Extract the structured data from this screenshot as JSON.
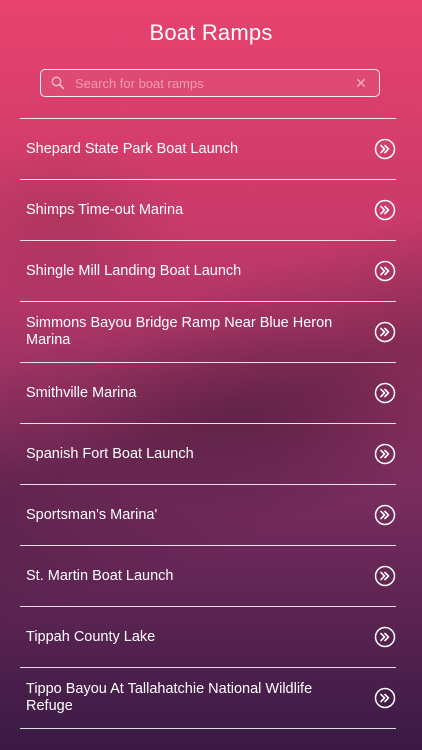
{
  "header": {
    "title": "Boat Ramps"
  },
  "search": {
    "placeholder": "Search for boat ramps",
    "value": ""
  },
  "icons": {
    "search": "search-icon",
    "clear": "close-icon",
    "row": "double-chevron-right-icon"
  },
  "list": {
    "items": [
      {
        "label": "Shepard State Park Boat Launch"
      },
      {
        "label": "Shimps Time-out Marina"
      },
      {
        "label": "Shingle Mill Landing Boat Launch"
      },
      {
        "label": "Simmons Bayou Bridge Ramp Near Blue Heron Marina"
      },
      {
        "label": "Smithville Marina"
      },
      {
        "label": "Spanish Fort Boat Launch"
      },
      {
        "label": "Sportsman's Marina'"
      },
      {
        "label": "St. Martin Boat Launch"
      },
      {
        "label": "Tippah County Lake"
      },
      {
        "label": "Tippo Bayou At Tallahatchie National Wildlife Refuge"
      }
    ]
  },
  "colors": {
    "gradient_top": "#e8426e",
    "gradient_bottom": "#3a1a45",
    "text": "#ffffff"
  }
}
